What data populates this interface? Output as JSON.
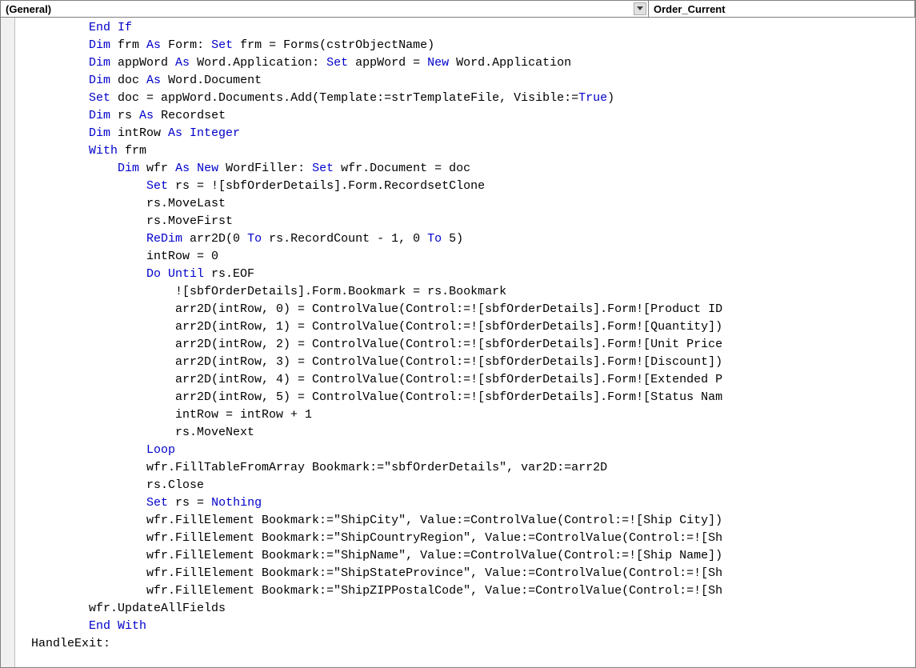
{
  "dropdowns": {
    "object": "(General)",
    "procedure": "Order_Current"
  },
  "code": {
    "lines": [
      {
        "indent": 8,
        "tokens": [
          [
            "kw",
            "End If"
          ]
        ]
      },
      {
        "indent": 8,
        "tokens": [
          [
            "kw",
            "Dim"
          ],
          [
            "",
            " frm "
          ],
          [
            "kw",
            "As"
          ],
          [
            "",
            " Form: "
          ],
          [
            "kw",
            "Set"
          ],
          [
            "",
            " frm = Forms(cstrObjectName)"
          ]
        ]
      },
      {
        "indent": 8,
        "tokens": [
          [
            "kw",
            "Dim"
          ],
          [
            "",
            " appWord "
          ],
          [
            "kw",
            "As"
          ],
          [
            "",
            " Word.Application: "
          ],
          [
            "kw",
            "Set"
          ],
          [
            "",
            " appWord = "
          ],
          [
            "kw",
            "New"
          ],
          [
            "",
            " Word.Application"
          ]
        ]
      },
      {
        "indent": 8,
        "tokens": [
          [
            "kw",
            "Dim"
          ],
          [
            "",
            " doc "
          ],
          [
            "kw",
            "As"
          ],
          [
            "",
            " Word.Document"
          ]
        ]
      },
      {
        "indent": 8,
        "tokens": [
          [
            "kw",
            "Set"
          ],
          [
            "",
            " doc = appWord.Documents.Add(Template:=strTemplateFile, Visible:="
          ],
          [
            "kw",
            "True"
          ],
          [
            "",
            ")"
          ]
        ]
      },
      {
        "indent": 8,
        "tokens": [
          [
            "kw",
            "Dim"
          ],
          [
            "",
            " rs "
          ],
          [
            "kw",
            "As"
          ],
          [
            "",
            " Recordset"
          ]
        ]
      },
      {
        "indent": 8,
        "tokens": [
          [
            "kw",
            "Dim"
          ],
          [
            "",
            " intRow "
          ],
          [
            "kw",
            "As Integer"
          ]
        ]
      },
      {
        "indent": 8,
        "tokens": [
          [
            "kw",
            "With"
          ],
          [
            "",
            " frm"
          ]
        ]
      },
      {
        "indent": 12,
        "tokens": [
          [
            "kw",
            "Dim"
          ],
          [
            "",
            " wfr "
          ],
          [
            "kw",
            "As New"
          ],
          [
            "",
            " WordFiller: "
          ],
          [
            "kw",
            "Set"
          ],
          [
            "",
            " wfr.Document = doc"
          ]
        ]
      },
      {
        "indent": 16,
        "tokens": [
          [
            "kw",
            "Set"
          ],
          [
            "",
            " rs = ![sbfOrderDetails].Form.RecordsetClone"
          ]
        ]
      },
      {
        "indent": 16,
        "tokens": [
          [
            "",
            "rs.MoveLast"
          ]
        ]
      },
      {
        "indent": 16,
        "tokens": [
          [
            "",
            "rs.MoveFirst"
          ]
        ]
      },
      {
        "indent": 16,
        "tokens": [
          [
            "kw",
            "ReDim"
          ],
          [
            "",
            " arr2D(0 "
          ],
          [
            "kw",
            "To"
          ],
          [
            "",
            " rs.RecordCount - 1, 0 "
          ],
          [
            "kw",
            "To"
          ],
          [
            "",
            " 5)"
          ]
        ]
      },
      {
        "indent": 16,
        "tokens": [
          [
            "",
            "intRow = 0"
          ]
        ]
      },
      {
        "indent": 16,
        "tokens": [
          [
            "kw",
            "Do Until"
          ],
          [
            "",
            " rs.EOF"
          ]
        ]
      },
      {
        "indent": 20,
        "tokens": [
          [
            "",
            "![sbfOrderDetails].Form.Bookmark = rs.Bookmark"
          ]
        ]
      },
      {
        "indent": 20,
        "tokens": [
          [
            "",
            "arr2D(intRow, 0) = ControlValue(Control:=![sbfOrderDetails].Form![Product ID"
          ]
        ]
      },
      {
        "indent": 20,
        "tokens": [
          [
            "",
            "arr2D(intRow, 1) = ControlValue(Control:=![sbfOrderDetails].Form![Quantity])"
          ]
        ]
      },
      {
        "indent": 20,
        "tokens": [
          [
            "",
            "arr2D(intRow, 2) = ControlValue(Control:=![sbfOrderDetails].Form![Unit Price"
          ]
        ]
      },
      {
        "indent": 20,
        "tokens": [
          [
            "",
            "arr2D(intRow, 3) = ControlValue(Control:=![sbfOrderDetails].Form![Discount])"
          ]
        ]
      },
      {
        "indent": 20,
        "tokens": [
          [
            "",
            "arr2D(intRow, 4) = ControlValue(Control:=![sbfOrderDetails].Form![Extended P"
          ]
        ]
      },
      {
        "indent": 20,
        "tokens": [
          [
            "",
            "arr2D(intRow, 5) = ControlValue(Control:=![sbfOrderDetails].Form![Status Nam"
          ]
        ]
      },
      {
        "indent": 20,
        "tokens": [
          [
            "",
            "intRow = intRow + 1"
          ]
        ]
      },
      {
        "indent": 20,
        "tokens": [
          [
            "",
            "rs.MoveNext"
          ]
        ]
      },
      {
        "indent": 16,
        "tokens": [
          [
            "kw",
            "Loop"
          ]
        ]
      },
      {
        "indent": 16,
        "tokens": [
          [
            "",
            "wfr.FillTableFromArray Bookmark:=\"sbfOrderDetails\", var2D:=arr2D"
          ]
        ]
      },
      {
        "indent": 16,
        "tokens": [
          [
            "",
            "rs.Close"
          ]
        ]
      },
      {
        "indent": 16,
        "tokens": [
          [
            "kw",
            "Set"
          ],
          [
            "",
            " rs = "
          ],
          [
            "kw",
            "Nothing"
          ]
        ]
      },
      {
        "indent": 16,
        "tokens": [
          [
            "",
            "wfr.FillElement Bookmark:=\"ShipCity\", Value:=ControlValue(Control:=![Ship City])"
          ]
        ]
      },
      {
        "indent": 16,
        "tokens": [
          [
            "",
            "wfr.FillElement Bookmark:=\"ShipCountryRegion\", Value:=ControlValue(Control:=![Sh"
          ]
        ]
      },
      {
        "indent": 16,
        "tokens": [
          [
            "",
            "wfr.FillElement Bookmark:=\"ShipName\", Value:=ControlValue(Control:=![Ship Name])"
          ]
        ]
      },
      {
        "indent": 16,
        "tokens": [
          [
            "",
            "wfr.FillElement Bookmark:=\"ShipStateProvince\", Value:=ControlValue(Control:=![Sh"
          ]
        ]
      },
      {
        "indent": 16,
        "tokens": [
          [
            "",
            "wfr.FillElement Bookmark:=\"ShipZIPPostalCode\", Value:=ControlValue(Control:=![Sh"
          ]
        ]
      },
      {
        "indent": 8,
        "tokens": [
          [
            "",
            "wfr.UpdateAllFields"
          ]
        ]
      },
      {
        "indent": 8,
        "tokens": [
          [
            "kw",
            "End With"
          ]
        ]
      },
      {
        "indent": 0,
        "tokens": [
          [
            "",
            "HandleExit:"
          ]
        ]
      }
    ]
  }
}
